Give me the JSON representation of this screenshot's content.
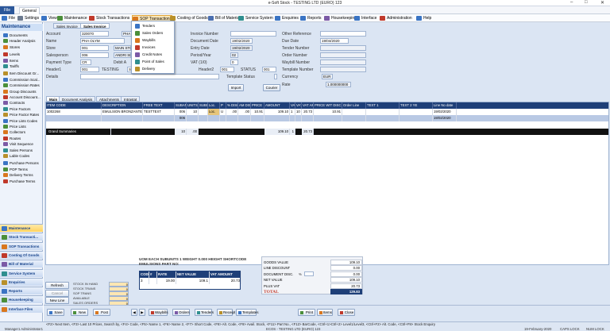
{
  "window": {
    "title": "e-Soft Stock - TESTING LTD (EURO) 123",
    "controls": [
      "–",
      "□",
      "✕"
    ]
  },
  "menu": {
    "file": "File",
    "general": "General"
  },
  "ribbon": [
    {
      "label": "File",
      "color": "#3a74c4"
    },
    {
      "label": "Settings",
      "color": "#6c7a8f"
    },
    {
      "label": "View",
      "color": "#3a74c4"
    },
    {
      "label": "Maintenance",
      "color": "#4b8f3a"
    },
    {
      "label": "Stock Transactions",
      "color": "#c0392b"
    },
    {
      "label": "SOP Transactions",
      "color": "#d9771e"
    },
    {
      "label": "Costing of Goods",
      "color": "#b8902a"
    },
    {
      "label": "Bill of Material",
      "color": "#4a6fb0"
    },
    {
      "label": "Service System",
      "color": "#2f8f8f"
    },
    {
      "label": "Enquiries",
      "color": "#3a74c4"
    },
    {
      "label": "Reports",
      "color": "#3a74c4"
    },
    {
      "label": "Housekeeping",
      "color": "#7b5aa6"
    },
    {
      "label": "Interface",
      "color": "#3a74c4"
    },
    {
      "label": "Administration",
      "color": "#c0392b"
    },
    {
      "label": "Help",
      "color": "#3a74c4"
    }
  ],
  "sop_menu": {
    "items": [
      "Tenders",
      "Sales Orders",
      "Waybills",
      "Invoices",
      "Credit Notes",
      "Point of Sales",
      "Delivery"
    ],
    "colors": [
      "#3a74c4",
      "#4b8f3a",
      "#d9771e",
      "#c0392b",
      "#7b5aa6",
      "#2f8f8f",
      "#b8902a"
    ]
  },
  "sidebar": {
    "title": "Maintenance",
    "items": [
      "Documents",
      "Header Analysis",
      "Stores",
      "Levels",
      "Items",
      "Tariffs",
      "Item Discount Gr...",
      "Commission Scal...",
      "Commission Rates",
      "Group Discounts",
      "Account Discount...",
      "Contracts",
      "Price Factors",
      "Price Factor Rates",
      "Price Lists Codes",
      "Price Lists",
      "Collectors",
      "Routes",
      "Visit Sequence",
      "Sales Persons",
      "Lable Codes",
      "Purchase Persons",
      "POP Terms",
      "Delivery Terms",
      "Purchase Terms"
    ],
    "categories": [
      "Maintenance",
      "Stock Transacti...",
      "SOP Transactions",
      "Costing Of Goods",
      "Bill of Material",
      "Service System",
      "Enquiries",
      "Reports",
      "Housekeeping",
      "Interface Files"
    ]
  },
  "doc_tabs": [
    "Sales Invoice",
    "Sales Invoice"
  ],
  "form": {
    "account_label": "Account",
    "account": "320070",
    "account_name": "PHA",
    "name_label": "Name",
    "name": "PHA OLYM",
    "store_label": "Store",
    "store": "001",
    "store_name": "MAIN STO",
    "salesperson_label": "Salesperson",
    "salesperson": "006",
    "salesperson_name": "ANDRI SK",
    "payment_label": "Payment Type",
    "payment": "CR",
    "debit_label": "Debit A",
    "header1_label": "Header1",
    "header1": "001",
    "testing": "TESTING",
    "header1_sub": "SG",
    "details_label": "Details",
    "invoice_label": "Invoice Number",
    "document_date_label": "Document Date",
    "document_date": "19/02/2020",
    "entry_date_label": "Entry Date",
    "entry_date": "19/02/2020",
    "period_label": "Period/Year",
    "period": "02",
    "vat_label": "VAT (1/0)",
    "vat": "0",
    "header2_label": "Header2",
    "header2": "001",
    "status_label": "STATUS",
    "status": "001",
    "template_status_label": "Template Status",
    "import": "Import",
    "courier": "Courier",
    "other_ref_label": "Other Reference",
    "due_date_label": "Due Date",
    "due_date": "19/04/2020",
    "tender_label": "Tender Number",
    "order_label": "Order Number",
    "waybill_label": "Waybill Number",
    "template_label": "Template Number",
    "currency_label": "Currency",
    "currency": "EUR",
    "rate_label": "Rate",
    "rate": "1.000000000"
  },
  "grid_tabs": [
    "Main",
    "Document Analysis",
    "Attachments",
    "Intrastat"
  ],
  "grid": {
    "columns": [
      "ITEM CODE",
      "DESCRIPTION",
      "FREE TEXT",
      "SUBAN",
      "UNITS",
      "SUBUN",
      "Loc.",
      "P",
      "% DISC",
      "AM DISC",
      "PRICE",
      "AMOUNT",
      "VAT",
      "VAT %",
      "VAT AM",
      "PRICE WIT DISC",
      "Order Line",
      "TEXT 1",
      "TEXT 2 YE",
      "Line No date"
    ],
    "rows": [
      [
        "1002268",
        "EMULSION BRONZANTE SPF 4 250",
        "TESTTEXT",
        "006",
        "10",
        "",
        "Loc.",
        "U",
        ".00",
        ".00",
        "10.91",
        "109.10",
        "1",
        "10",
        "20.73",
        "10.91",
        "",
        "",
        "",
        "19/02/2020"
      ],
      [
        "",
        "",
        "",
        "006",
        "",
        "",
        "",
        "",
        "",
        "",
        "",
        "",
        "",
        "",
        "",
        "",
        "",
        "",
        "",
        "19/02/2020"
      ]
    ],
    "totals": {
      "label": "Grand Summaries",
      "suban": "10",
      "units": ".00",
      "amount": "109.10",
      "vat": "1",
      "vat_am": "20.73"
    }
  },
  "side_buttons": [
    "Refresh",
    "Cancel",
    "New Line",
    "Change",
    "Profit"
  ],
  "stock_info": {
    "labels": [
      "STOCK IN HAND",
      "STOCK TRANS",
      "SOP TRANS",
      "AVAILABLE",
      "SALES ORDERS",
      "POP ORDERS",
      "NET"
    ],
    "values": [
      "0",
      "0",
      "0",
      "0",
      "0",
      "0",
      "0"
    ]
  },
  "unit_info": {
    "line1": "UOM EACH SUBUNITS 1 WEIGHT 0.000 HEIGHT SHORTCODE",
    "line2": "EMULSIONS PART NO:"
  },
  "prop_table": {
    "headers": [
      "CODE",
      "#",
      "RATE",
      "NET VALUE",
      "VAT AMOUNT"
    ],
    "row": [
      "3",
      "",
      "19.00",
      "109.1",
      "20.73"
    ]
  },
  "totals": {
    "labels": [
      "GOODS VALUE",
      "LINE DISCOUNT",
      "DOCUMENT DISC.",
      "NET VALUE",
      "PLUS VAT"
    ],
    "values": [
      "109.10",
      "0.00",
      "0.00",
      "109.10",
      "20.73"
    ],
    "pct": "%",
    "total_label": "TOTAL",
    "total": "129.83"
  },
  "bottom_buttons": [
    "Save",
    "New",
    "Post",
    "Waybills",
    "Orders",
    "Tenders",
    "Receipt",
    "Templates",
    "Print",
    "Items",
    "Close"
  ],
  "shortcuts": "<F2> Next Item, <F3> Last 10 Prices, Search by, <F4> Code, <F5> Name 1, <F6> Name 2, <F7> Short Code, <F8> Alt. Code, <F9> Avail. Stock, <F11> Part No., <F12> BarCode, <Ctrl+1>Ctrl+2> Level1/Level3, <Ctrl+F2> Alt. Code, <Ctrl+F9> Stock Enquiry",
  "status": {
    "user": "Manager1 Administrator1",
    "company": "ECOS - TESTING LTD (EURO) 123",
    "date": "19-February-2020",
    "caps": "CAPS LOCK",
    "num": "NUM LOCK"
  }
}
